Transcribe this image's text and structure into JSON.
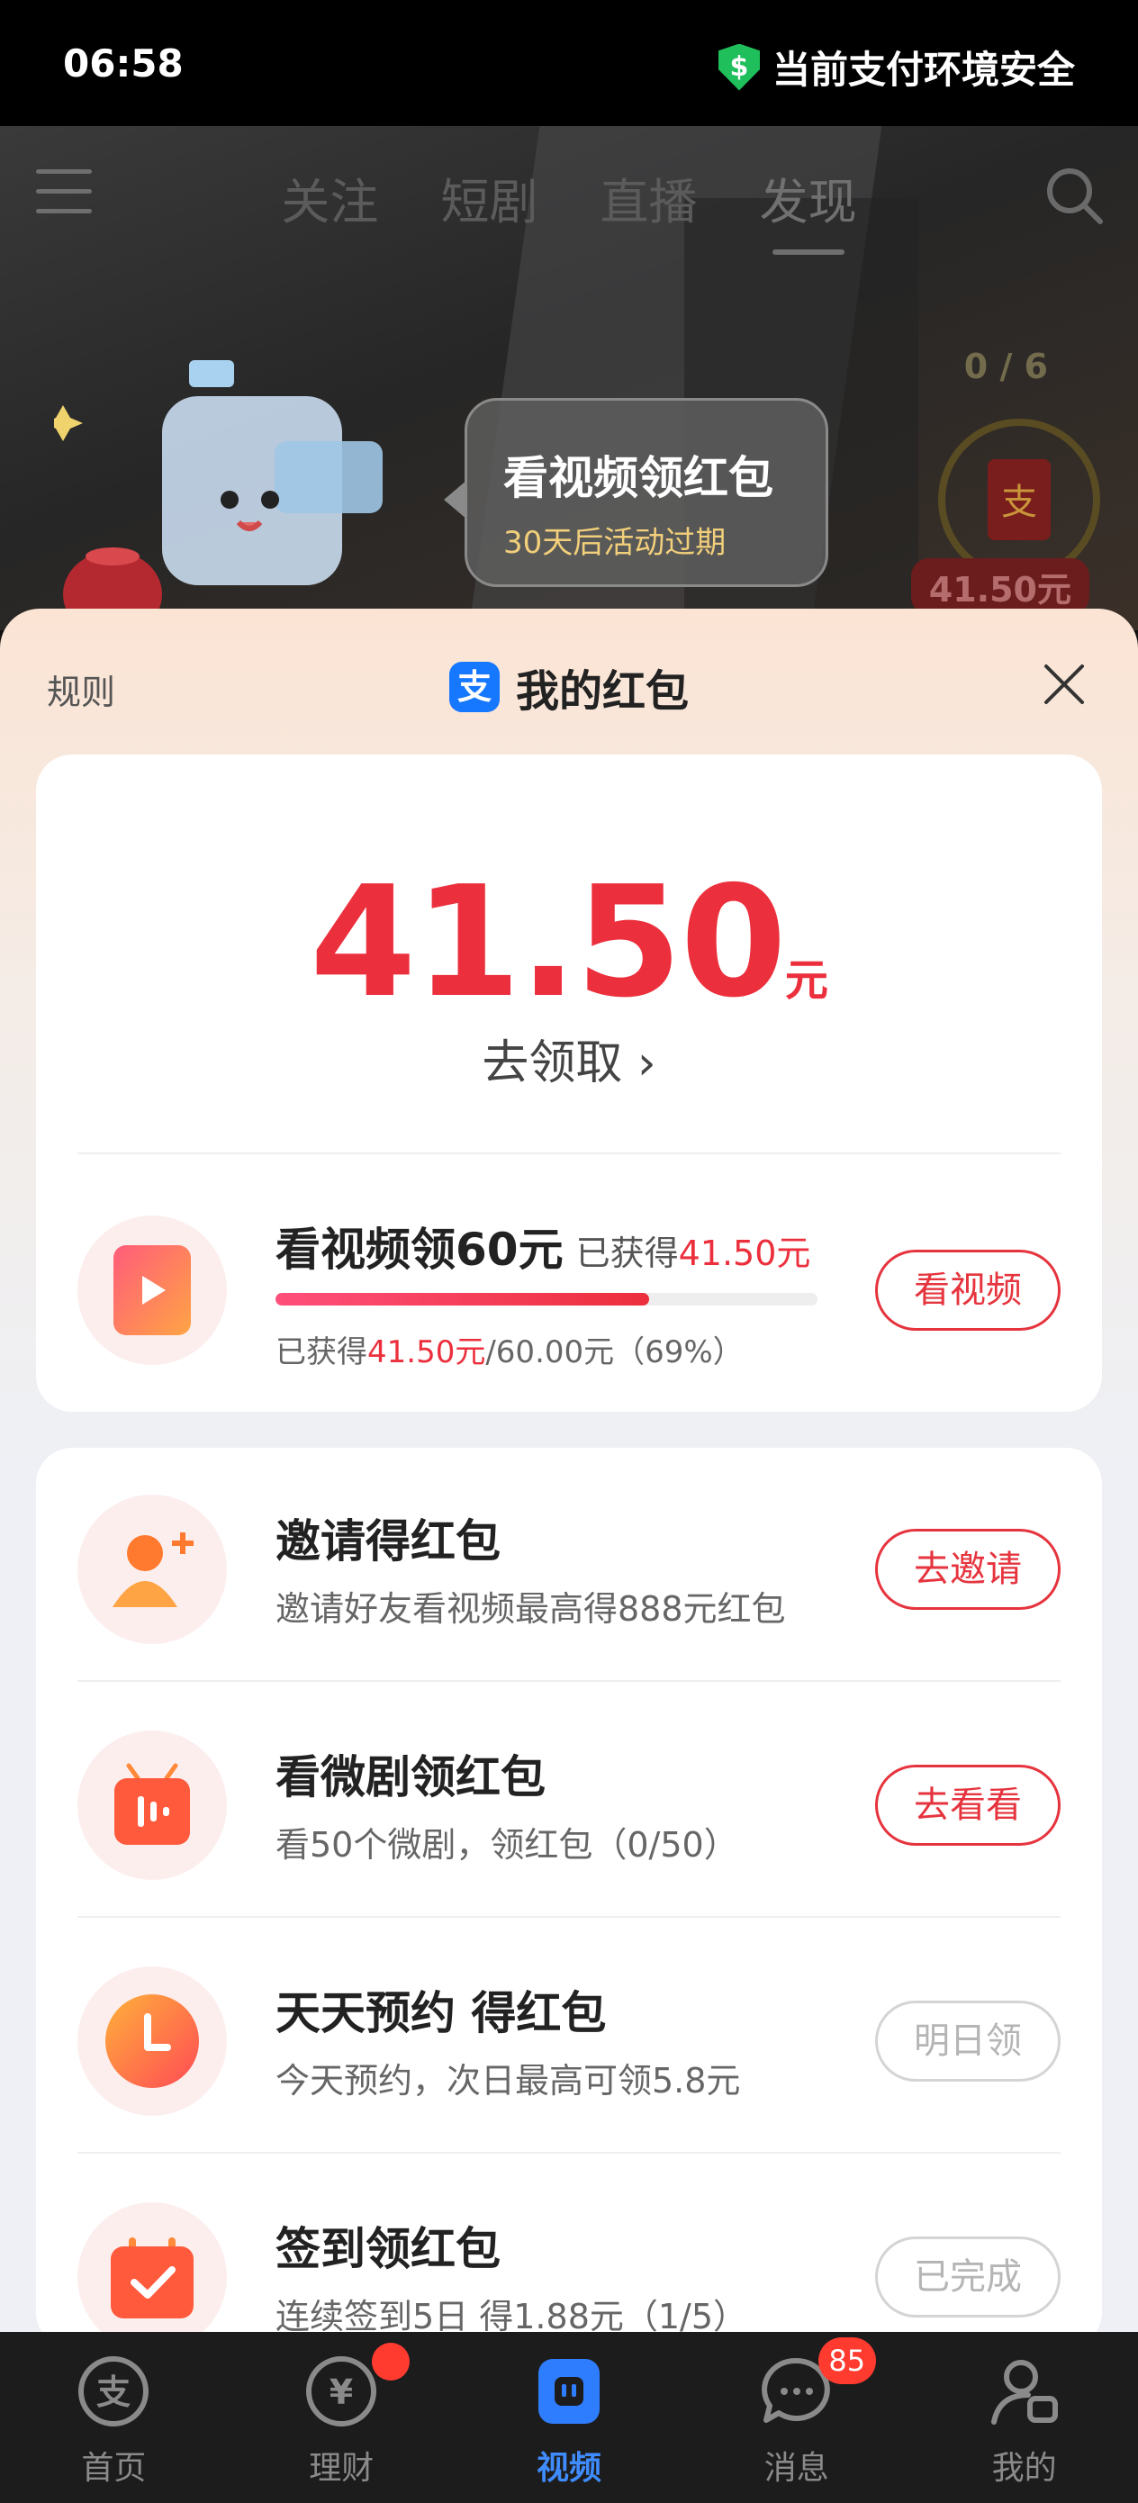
{
  "status_bar": {
    "time": "06:58",
    "security_text": "当前支付环境安全"
  },
  "top_nav": {
    "tabs": [
      "关注",
      "短剧",
      "直播",
      "发现"
    ],
    "active_tab": "发现"
  },
  "hero": {
    "counter": "0 / 6",
    "amount_tag": "41.50元",
    "bubble_title": "看视频领红包",
    "bubble_sub": "30天后活动过期"
  },
  "sheet": {
    "rules_label": "规则",
    "title": "我的红包",
    "logo_glyph": "支",
    "balance_amount": "41.50",
    "balance_unit": "元",
    "claim_label": "去领取 ›"
  },
  "watch_task": {
    "title": "看视频领60元",
    "obtained_label": "已获得",
    "obtained_amount": "41.50元",
    "progress_prefix": "已获得",
    "progress_amount": "41.50元",
    "progress_suffix": "/60.00元（69%）",
    "progress_fraction": 0.69,
    "button": "看视频"
  },
  "tasks": [
    {
      "title": "邀请得红包",
      "subtitle": "邀请好友看视频最高得888元红包",
      "button": "去邀请",
      "enabled": true,
      "icon": "invite-user-icon"
    },
    {
      "title": "看微剧领红包",
      "subtitle": "看50个微剧，领红包（0/50）",
      "button": "去看看",
      "enabled": true,
      "icon": "mini-drama-tv-icon"
    },
    {
      "title": "天天预约 得红包",
      "subtitle": "今天预约，次日最高可领5.8元",
      "button": "明日领",
      "enabled": false,
      "icon": "clock-icon"
    },
    {
      "title": "签到领红包",
      "subtitle": "连续签到5日 得1.88元（1/5）",
      "button": "已完成",
      "enabled": false,
      "icon": "calendar-check-icon"
    }
  ],
  "tab_bar": {
    "items": [
      {
        "label": "首页",
        "icon": "alipay-home-icon"
      },
      {
        "label": "理财",
        "icon": "wealth-icon"
      },
      {
        "label": "视频",
        "icon": "video-icon"
      },
      {
        "label": "消息",
        "icon": "message-icon"
      },
      {
        "label": "我的",
        "icon": "profile-icon"
      }
    ],
    "message_badge": "85",
    "active_index": 2
  },
  "colors": {
    "accent_red": "#ec2f3c",
    "active_blue": "#3f8cff"
  }
}
